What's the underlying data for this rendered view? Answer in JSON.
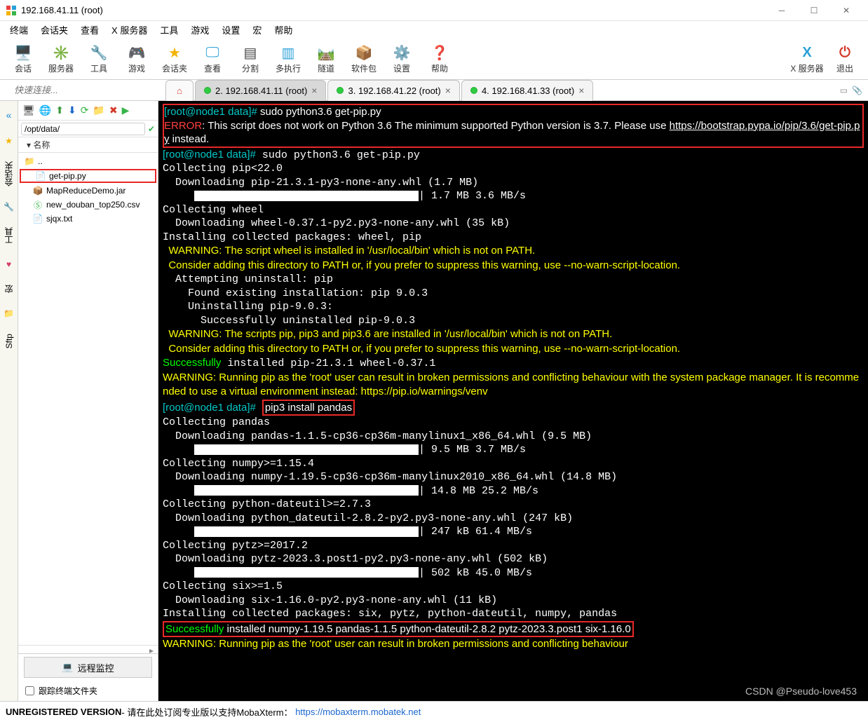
{
  "title": "192.168.41.11 (root)",
  "menu": {
    "items": [
      "终端",
      "会话夹",
      "查看",
      "X 服务器",
      "工具",
      "游戏",
      "设置",
      "宏",
      "帮助"
    ]
  },
  "toolbar": [
    {
      "label": "会话",
      "glyph": "🖥️",
      "color": "#2aa0d8"
    },
    {
      "label": "服务器",
      "glyph": "✳️",
      "color": "#39b54a"
    },
    {
      "label": "工具",
      "glyph": "🔧",
      "color": "#e08a2a"
    },
    {
      "label": "游戏",
      "glyph": "🎮",
      "color": "#7a5ccc"
    },
    {
      "label": "会话夹",
      "glyph": "★",
      "color": "#f5b400"
    },
    {
      "label": "查看",
      "glyph": "🖵",
      "color": "#2aa0d8"
    },
    {
      "label": "分割",
      "glyph": "▤",
      "color": "#444"
    },
    {
      "label": "多执行",
      "glyph": "▥",
      "color": "#2aa0d8"
    },
    {
      "label": "隧道",
      "glyph": "🛤️",
      "color": "#7a7a7a"
    },
    {
      "label": "软件包",
      "glyph": "📦",
      "color": "#c08a40"
    },
    {
      "label": "设置",
      "glyph": "⚙️",
      "color": "#555"
    },
    {
      "label": "帮助",
      "glyph": "❓",
      "color": "#1a88d8"
    }
  ],
  "toolbar_right": [
    {
      "label": "X 服务器",
      "glyph": "X",
      "color": "#2aa0d8"
    },
    {
      "label": "退出",
      "glyph": "⏻",
      "color": "#d43a2a"
    }
  ],
  "quick_placeholder": "快速连接...",
  "tabs": [
    {
      "home": true
    },
    {
      "label": "2. 192.168.41.11 (root)",
      "active": true
    },
    {
      "label": "3. 192.168.41.22 (root)"
    },
    {
      "label": "4. 192.168.41.33 (root)"
    }
  ],
  "side_tabs": [
    "«",
    "★",
    "会话夹",
    "🔧",
    "工具",
    "♥",
    "宏",
    "📁",
    "Sftp"
  ],
  "left": {
    "path": "/opt/data/",
    "name_col": "名称",
    "items": [
      {
        "label": "..",
        "type": "folder"
      },
      {
        "label": "get-pip.py",
        "type": "file",
        "hl": true
      },
      {
        "label": "MapReduceDemo.jar",
        "type": "jar"
      },
      {
        "label": "new_douban_top250.csv",
        "type": "csv"
      },
      {
        "label": "sjqx.txt",
        "type": "file"
      }
    ],
    "button": "远程监控",
    "checkbox": "跟踪终端文件夹"
  },
  "prompt": {
    "user": "root",
    "host": "node1",
    "cwd": "data",
    "sym": "#"
  },
  "term": {
    "cmd1": "sudo python3.6 get-pip.py",
    "err": "ERROR",
    "err_msg1": ": This script does not work on Python 3.6 The minimum supported Python version is 3.7. Please use ",
    "err_link": "https://bootstrap.pypa.io/pip/3.6/get-pip.py",
    "err_msg2": " instead.",
    "cmd2": "sudo python3.6 get-pip.py",
    "l1": "Collecting pip<22.0",
    "l2": "  Downloading pip-21.3.1-py3-none-any.whl (1.7 MB)",
    "l2b": "| 1.7 MB 3.6 MB/s",
    "l3": "Collecting wheel",
    "l4": "  Downloading wheel-0.37.1-py2.py3-none-any.whl (35 kB)",
    "l5": "Installing collected packages: wheel, pip",
    "w1": "  WARNING: The script wheel is installed in '/usr/local/bin' which is not on PATH.",
    "w2": "  Consider adding this directory to PATH or, if you prefer to suppress this warning, use --no-warn-script-location.",
    "l6": "  Attempting uninstall: pip",
    "l7": "    Found existing installation: pip 9.0.3",
    "l8": "    Uninstalling pip-9.0.3:",
    "l9": "      Successfully uninstalled pip-9.0.3",
    "w3": "  WARNING: The scripts pip, pip3 and pip3.6 are installed in '/usr/local/bin' which is not on PATH.",
    "w4": "  Consider adding this directory to PATH or, if you prefer to suppress this warning, use --no-warn-script-location.",
    "s1a": "Successfully",
    "s1b": " installed pip-21.3.1 wheel-0.37.1",
    "w5": "WARNING: Running pip as the 'root' user can result in broken permissions and conflicting behaviour with the system package manager. It is recommended to use a virtual environment instead: https://pip.io/warnings/venv",
    "cmd3": "pip3 install pandas",
    "p1": "Collecting pandas",
    "p2": "  Downloading pandas-1.1.5-cp36-cp36m-manylinux1_x86_64.whl (9.5 MB)",
    "p2b": "| 9.5 MB 3.7 MB/s",
    "p3": "Collecting numpy>=1.15.4",
    "p4": "  Downloading numpy-1.19.5-cp36-cp36m-manylinux2010_x86_64.whl (14.8 MB)",
    "p4b": "| 14.8 MB 25.2 MB/s",
    "p5": "Collecting python-dateutil>=2.7.3",
    "p6": "  Downloading python_dateutil-2.8.2-py2.py3-none-any.whl (247 kB)",
    "p6b": "| 247 kB 61.4 MB/s",
    "p7": "Collecting pytz>=2017.2",
    "p8": "  Downloading pytz-2023.3.post1-py2.py3-none-any.whl (502 kB)",
    "p8b": "| 502 kB 45.0 MB/s",
    "p9": "Collecting six>=1.5",
    "p10": "  Downloading six-1.16.0-py2.py3-none-any.whl (11 kB)",
    "p11": "Installing collected packages: six, pytz, python-dateutil, numpy, pandas",
    "s2a": "Successfully",
    "s2b": " installed numpy-1.19.5 pandas-1.1.5 python-dateutil-2.8.2 pytz-2023.3.post1 six-1.16.0",
    "w6": "WARNING: Running pip as the 'root' user can result in broken permissions and conflicting behaviour"
  },
  "status": {
    "left": "UNREGISTERED VERSION",
    "mid": " - 请在此处订阅专业版以支持MobaXterm：",
    "link": "https://mobaxterm.mobatek.net"
  },
  "watermark": "CSDN @Pseudo-love453"
}
